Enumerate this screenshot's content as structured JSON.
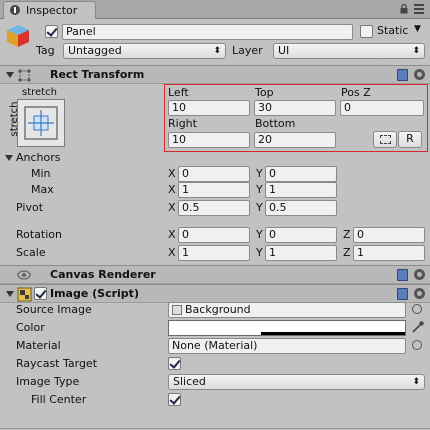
{
  "tab": {
    "title": "Inspector"
  },
  "object": {
    "name": "Panel",
    "active": true,
    "static_label": "Static",
    "tag_label": "Tag",
    "tag_value": "Untagged",
    "layer_label": "Layer",
    "layer_value": "UI"
  },
  "rect_transform": {
    "title": "Rect Transform",
    "anchor_preset_label": "stretch",
    "anchor_preset_side": "stretch",
    "left_label": "Left",
    "left": "10",
    "top_label": "Top",
    "top": "30",
    "posz_label": "Pos Z",
    "posz": "0",
    "right_label": "Right",
    "right": "10",
    "bottom_label": "Bottom",
    "bottom": "20",
    "raw_button": "R",
    "anchors_label": "Anchors",
    "min_label": "Min",
    "min_x": "0",
    "min_y": "0",
    "max_label": "Max",
    "max_x": "1",
    "max_y": "1",
    "pivot_label": "Pivot",
    "pivot_x": "0.5",
    "pivot_y": "0.5",
    "rotation_label": "Rotation",
    "rot_x": "0",
    "rot_y": "0",
    "rot_z": "0",
    "scale_label": "Scale",
    "scale_x": "1",
    "scale_y": "1",
    "scale_z": "1",
    "x_label": "X",
    "y_label": "Y",
    "z_label": "Z",
    "highlight_color": "#d42a2a"
  },
  "canvas_renderer": {
    "title": "Canvas Renderer"
  },
  "image": {
    "title": "Image (Script)",
    "enabled": true,
    "source_image_label": "Source Image",
    "source_image_value": "Background",
    "color_label": "Color",
    "color_value": "#ffffff",
    "material_label": "Material",
    "material_value": "None (Material)",
    "raycast_label": "Raycast Target",
    "raycast": true,
    "image_type_label": "Image Type",
    "image_type_value": "Sliced",
    "fill_center_label": "Fill Center",
    "fill_center": true
  }
}
